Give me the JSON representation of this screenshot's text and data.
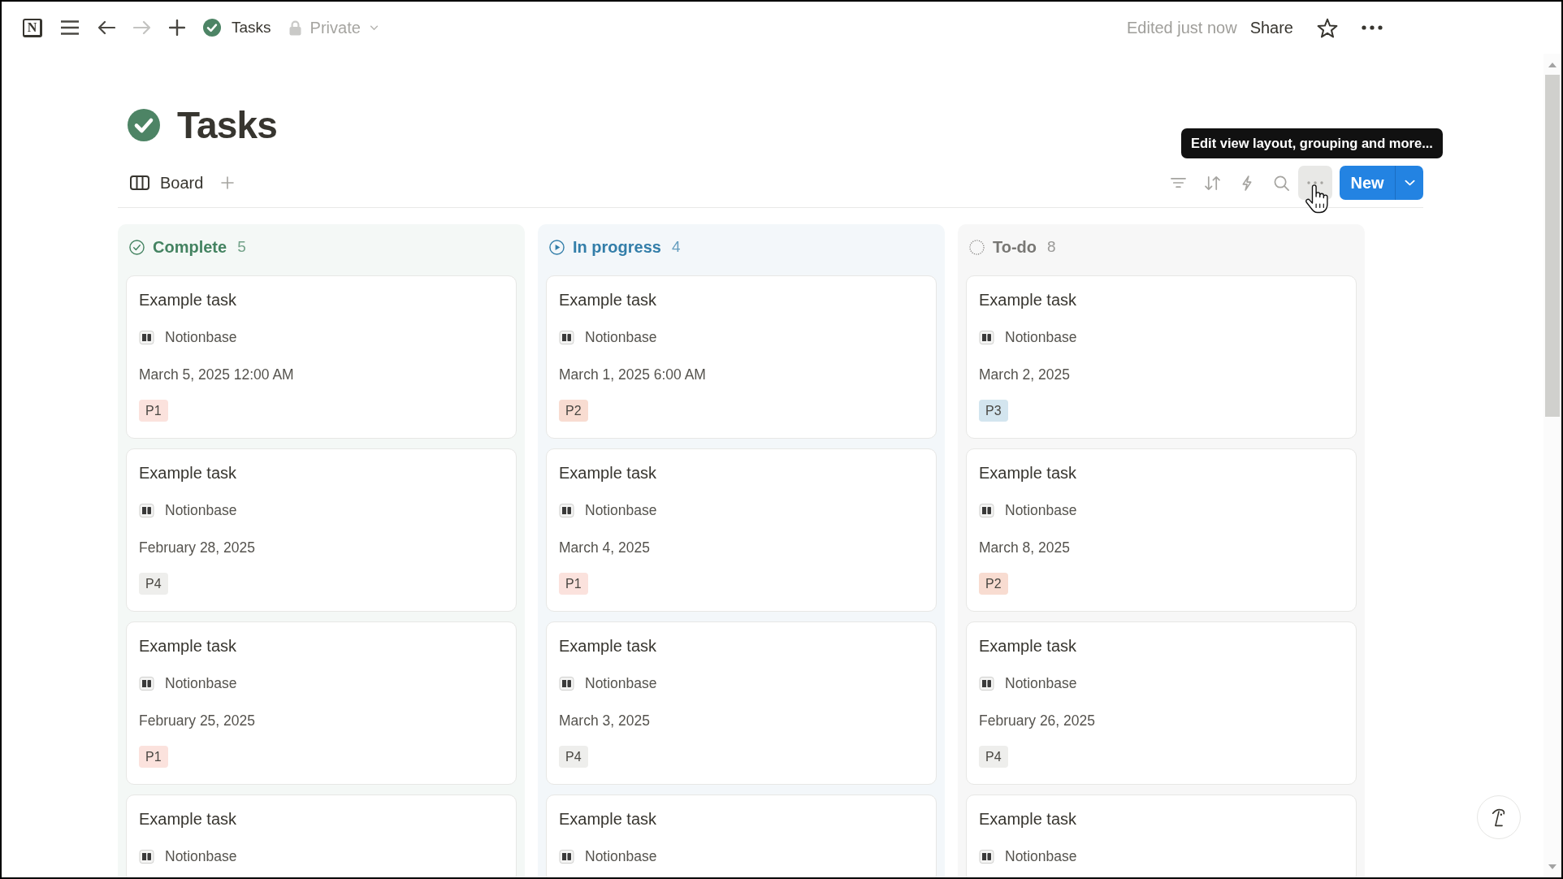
{
  "top_bar": {
    "logo": "N",
    "navigation": [
      {
        "kind": "back",
        "disabled": false
      },
      {
        "kind": "forward",
        "disabled": true
      }
    ],
    "breadcrumb": "Tasks",
    "privacy": "Private",
    "edited": "Edited just now",
    "share": "Share"
  },
  "page": {
    "title": "Tasks"
  },
  "views": {
    "tabs": [
      {
        "label": "Board",
        "selected": true
      }
    ]
  },
  "toolbar": {
    "more_hovered": true,
    "tooltip": "Edit view layout, grouping and more...",
    "new_button": "New"
  },
  "board": {
    "columns": [
      {
        "title": "Complete",
        "count": "5",
        "kind": "done",
        "color": "#448361",
        "cards": [
          {
            "title": "Example task",
            "source": "Notionbase",
            "date": "March 5, 2025 12:00 AM",
            "tag": {
              "label": "P1",
              "color": "#fbe2dd"
            }
          },
          {
            "title": "Example task",
            "source": "Notionbase",
            "date": "February 28, 2025",
            "tag": {
              "label": "P4",
              "color": "#eeeeec"
            }
          },
          {
            "title": "Example task",
            "source": "Notionbase",
            "date": "February 25, 2025",
            "tag": {
              "label": "P1",
              "color": "#fbe2dd"
            }
          },
          {
            "title": "Example task",
            "source": "Notionbase"
          }
        ]
      },
      {
        "title": "In progress",
        "count": "4",
        "kind": "in_progress",
        "color": "#337ea9",
        "cards": [
          {
            "title": "Example task",
            "source": "Notionbase",
            "date": "March 1, 2025 6:00 AM",
            "tag": {
              "label": "P2",
              "color": "#f8dcd1"
            }
          },
          {
            "title": "Example task",
            "source": "Notionbase",
            "date": "March 4, 2025",
            "tag": {
              "label": "P1",
              "color": "#fbe2dd"
            }
          },
          {
            "title": "Example task",
            "source": "Notionbase",
            "date": "March 3, 2025",
            "tag": {
              "label": "P4",
              "color": "#eeeeec"
            }
          },
          {
            "title": "Example task",
            "source": "Notionbase"
          }
        ]
      },
      {
        "title": "To-do",
        "count": "8",
        "kind": "not_started",
        "color": "#787774",
        "cards": [
          {
            "title": "Example task",
            "source": "Notionbase",
            "date": "March 2, 2025",
            "tag": {
              "label": "P3",
              "color": "#d3e5ef"
            }
          },
          {
            "title": "Example task",
            "source": "Notionbase",
            "date": "March 8, 2025",
            "tag": {
              "label": "P2",
              "color": "#f8dcd1"
            }
          },
          {
            "title": "Example task",
            "source": "Notionbase",
            "date": "February 26, 2025",
            "tag": {
              "label": "P4",
              "color": "#eeeeec"
            }
          },
          {
            "title": "Example task",
            "source": "Notionbase"
          }
        ]
      }
    ]
  }
}
